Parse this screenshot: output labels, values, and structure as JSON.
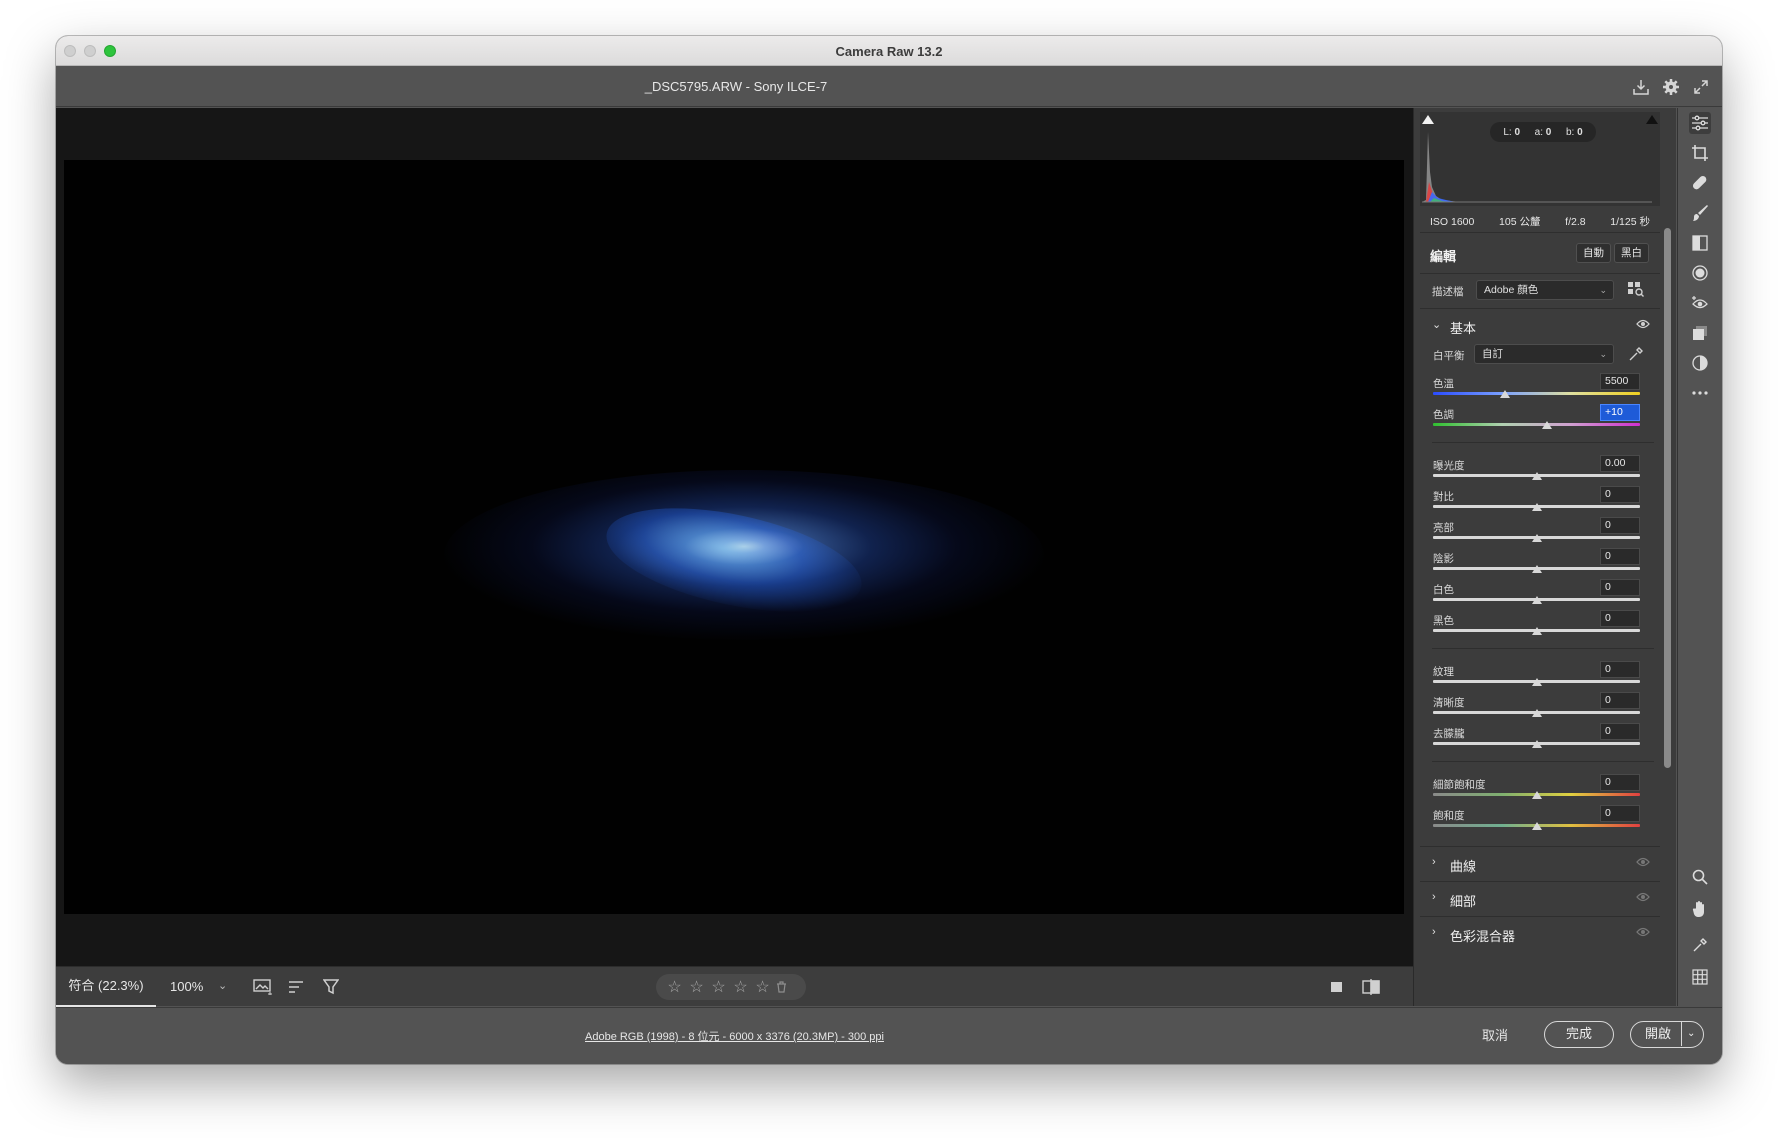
{
  "window": {
    "title": "Camera Raw 13.2",
    "file_title": "_DSC5795.ARW  -  Sony ILCE-7",
    "header_icons": [
      "save-icon",
      "gear-icon",
      "fullscreen-icon"
    ]
  },
  "histogram": {
    "lab": {
      "l_label": "L:",
      "l": "0",
      "a_label": "a:",
      "a": "0",
      "b_label": "b:",
      "b": "0"
    }
  },
  "exif": {
    "iso": "ISO 1600",
    "focal": "105 公釐",
    "aperture": "f/2.8",
    "shutter": "1/125 秒"
  },
  "edit": {
    "title": "編輯",
    "auto_label": "自動",
    "bw_label": "黑白",
    "profile_label": "描述檔",
    "profile_value": "Adobe 顏色",
    "basic_title": "基本",
    "wb_label": "白平衡",
    "wb_value": "自訂",
    "sliders": {
      "temp": {
        "label": "色溫",
        "value": "5500",
        "pos": 0.35
      },
      "tint": {
        "label": "色調",
        "value": "+10",
        "pos": 0.55
      },
      "exposure": {
        "label": "曝光度",
        "value": "0.00",
        "pos": 0.5
      },
      "contrast": {
        "label": "對比",
        "value": "0",
        "pos": 0.5
      },
      "highlights": {
        "label": "亮部",
        "value": "0",
        "pos": 0.5
      },
      "shadows": {
        "label": "陰影",
        "value": "0",
        "pos": 0.5
      },
      "whites": {
        "label": "白色",
        "value": "0",
        "pos": 0.5
      },
      "blacks": {
        "label": "黑色",
        "value": "0",
        "pos": 0.5
      },
      "texture": {
        "label": "紋理",
        "value": "0",
        "pos": 0.5
      },
      "clarity": {
        "label": "清晰度",
        "value": "0",
        "pos": 0.5
      },
      "dehaze": {
        "label": "去朦朧",
        "value": "0",
        "pos": 0.5
      },
      "vibrance": {
        "label": "細節飽和度",
        "value": "0",
        "pos": 0.5
      },
      "saturation": {
        "label": "飽和度",
        "value": "0",
        "pos": 0.5
      }
    },
    "collapsed": {
      "curve": "曲線",
      "detail": "細部",
      "color_mixer": "色彩混合器"
    }
  },
  "bottom_bar": {
    "zoom_fit": "符合 (22.3%)",
    "zoom_100": "100%",
    "rating_stars": [
      "☆",
      "☆",
      "☆",
      "☆",
      "☆"
    ]
  },
  "footer": {
    "workflow_link": "Adobe RGB (1998) - 8 位元 - 6000 x 3376 (20.3MP) - 300 ppi",
    "cancel": "取消",
    "done": "完成",
    "open": "開啟"
  },
  "colors": {
    "panel_bg": "#3c3c3c",
    "chrome_bg": "#535353",
    "accent_blue": "#1e5bd8",
    "traffic_green": "#2ec43d"
  }
}
